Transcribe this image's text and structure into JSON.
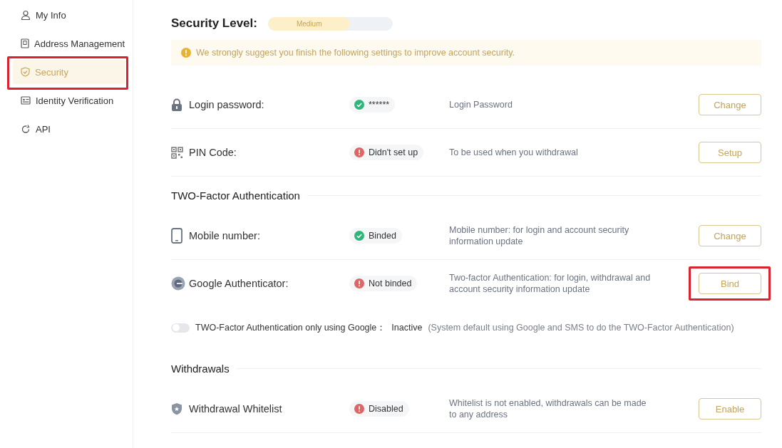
{
  "sidebar": {
    "items": [
      {
        "label": "My Info",
        "kind": "person",
        "selected": false,
        "highlighted": false
      },
      {
        "label": "Address Management",
        "kind": "book",
        "selected": false,
        "highlighted": false
      },
      {
        "label": "Security",
        "kind": "shield",
        "selected": true,
        "highlighted": true
      },
      {
        "label": "Identity Verification",
        "kind": "card",
        "selected": false,
        "highlighted": false
      },
      {
        "label": "API",
        "kind": "api",
        "selected": false,
        "highlighted": false
      }
    ]
  },
  "security_level": {
    "label": "Security Level:",
    "level": 0.66,
    "reading": "Medium"
  },
  "notice": "We strongly suggest you finish the following settings to improve account security.",
  "sections": [
    {
      "rows": [
        {
          "kind": "password",
          "label": "Login password:",
          "verified": true,
          "status_text": "******",
          "description": "Login Password",
          "button": "Change",
          "highlighted": false
        },
        {
          "kind": "pin",
          "label": "PIN Code:",
          "verified": false,
          "status_text": "Didn't set up",
          "description": "To be used when you withdrawal",
          "button": "Setup",
          "highlighted": false
        }
      ]
    },
    {
      "title": "TWO-Factor Authentication",
      "rows": [
        {
          "kind": "mobile",
          "label": "Mobile number:",
          "verified": true,
          "status_text": "Binded",
          "description": "Mobile number: for login and account security information update",
          "button": "Change",
          "highlighted": false
        },
        {
          "kind": "authenticator",
          "label": "Google Authenticator:",
          "verified": false,
          "status_text": "Not binded",
          "description": "Two-factor Authentication: for login, withdrawal and account security information update",
          "button": "Bind",
          "highlighted": true
        }
      ],
      "toggle": {
        "on": false,
        "label": "TWO-Factor Authentication only using Google：",
        "state": "Inactive",
        "note": "(System default using Google and SMS to do the TWO-Factor Authentication)"
      }
    },
    {
      "title": "Withdrawals",
      "rows": [
        {
          "kind": "whitelist",
          "label": "Withdrawal Whitelist",
          "verified": false,
          "status_text": "Disabled",
          "description": "Whitelist is not enabled, withdrawals can be made to any address",
          "button": "Enable",
          "highlighted": false
        }
      ]
    }
  ]
}
